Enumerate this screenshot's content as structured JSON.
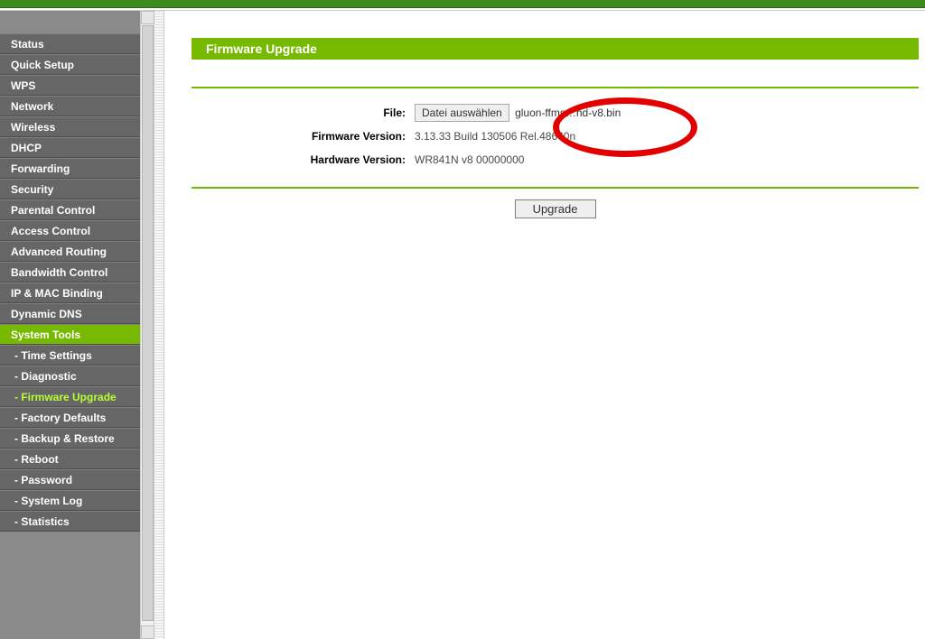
{
  "sidebar": {
    "items": [
      {
        "label": "Status"
      },
      {
        "label": "Quick Setup"
      },
      {
        "label": "WPS"
      },
      {
        "label": "Network"
      },
      {
        "label": "Wireless"
      },
      {
        "label": "DHCP"
      },
      {
        "label": "Forwarding"
      },
      {
        "label": "Security"
      },
      {
        "label": "Parental Control"
      },
      {
        "label": "Access Control"
      },
      {
        "label": "Advanced Routing"
      },
      {
        "label": "Bandwidth Control"
      },
      {
        "label": "IP & MAC Binding"
      },
      {
        "label": "Dynamic DNS"
      },
      {
        "label": "System Tools"
      }
    ],
    "subitems": [
      {
        "label": "- Time Settings"
      },
      {
        "label": "- Diagnostic"
      },
      {
        "label": "- Firmware Upgrade"
      },
      {
        "label": "- Factory Defaults"
      },
      {
        "label": "- Backup & Restore"
      },
      {
        "label": "- Reboot"
      },
      {
        "label": "- Password"
      },
      {
        "label": "- System Log"
      },
      {
        "label": "- Statistics"
      }
    ]
  },
  "header": {
    "title": "Firmware Upgrade"
  },
  "form": {
    "file_label": "File:",
    "file_button": "Datei auswählen",
    "file_name": "gluon-ffms…nd-v8.bin",
    "fw_label": "Firmware Version:",
    "fw_value": "3.13.33 Build 130506 Rel.48660n",
    "hw_label": "Hardware Version:",
    "hw_value": "WR841N v8 00000000"
  },
  "actions": {
    "upgrade": "Upgrade"
  }
}
